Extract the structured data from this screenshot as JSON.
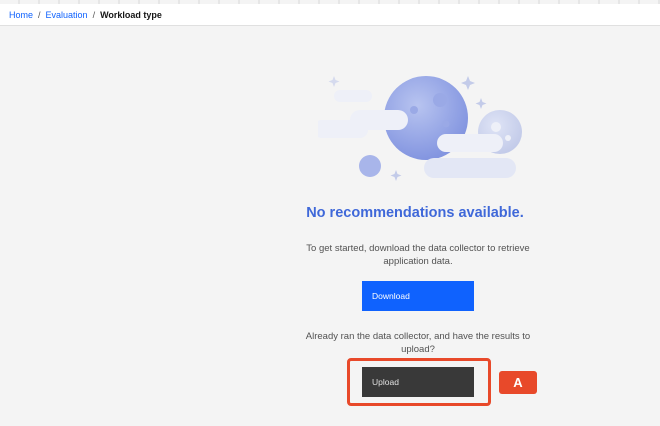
{
  "breadcrumb": {
    "items": [
      "Home",
      "Evaluation"
    ],
    "separator": "/",
    "current": "Workload type"
  },
  "empty_state": {
    "illustration_icon": "moon-clouds-illustration",
    "title": "No recommendations available.",
    "description": "To get started, download the data collector to retrieve application data.",
    "download_label": "Download",
    "upload_prompt": "Already ran the data collector, and have the results to upload?",
    "upload_label": "Upload"
  },
  "annotation": {
    "marker_label": "A",
    "color": "#e8492a"
  },
  "colors": {
    "primary_button": "#0f62fe",
    "secondary_button": "#393939",
    "title": "#3f68d9",
    "link": "#0f62fe"
  }
}
